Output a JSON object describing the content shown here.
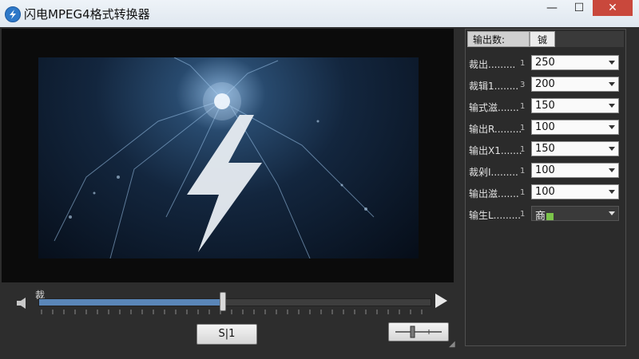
{
  "window": {
    "title": "闪电MPEG4格式转换器",
    "controls": {
      "minimize": "—",
      "maximize": "☐",
      "close": "✕"
    }
  },
  "player": {
    "seek_label": "裁",
    "progress": 0.47,
    "action_button_label": "S|1"
  },
  "settings": {
    "tabs": [
      {
        "label": "输出数:",
        "active": true
      },
      {
        "label": "铖",
        "active": false
      }
    ],
    "rows": [
      {
        "label": "裁出.........",
        "num": "1",
        "value": "250"
      },
      {
        "label": "裁辑1........",
        "num": "3",
        "value": "200"
      },
      {
        "label": "输式滋.......",
        "num": "1",
        "value": "150"
      },
      {
        "label": "输出R.........",
        "num": "1",
        "value": "100"
      },
      {
        "label": "输出X1.......",
        "num": "1",
        "value": "150"
      },
      {
        "label": "裁剁I.........",
        "num": "1",
        "value": "100"
      },
      {
        "label": "输出滋.......",
        "num": "1",
        "value": "100"
      },
      {
        "label": "输生L.........",
        "num": "1",
        "value": "商"
      }
    ]
  },
  "colors": {
    "accent": "#5a86b8",
    "panel": "#2d2d2d",
    "format_swatch": "#7bc44a"
  }
}
